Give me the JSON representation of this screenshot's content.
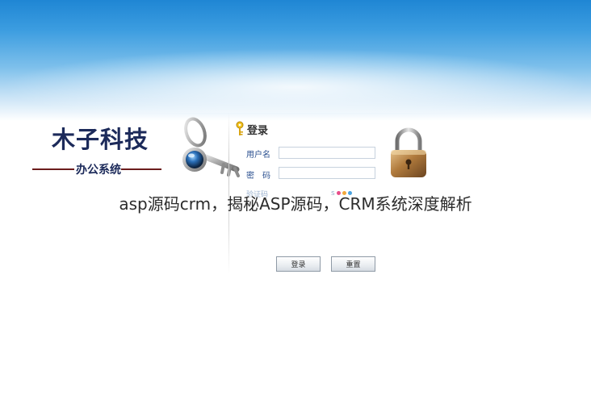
{
  "banner": {
    "caption": "asp源码crm，揭秘ASP源码，CRM系统深度解析"
  },
  "logo": {
    "title": "木子科技",
    "subtitle": "办公系统"
  },
  "login": {
    "heading": "登录",
    "username_label": "用户名",
    "username_value": "",
    "password_label": "密　码",
    "password_value": "",
    "extra_label": "验证码",
    "extra_marks": "s",
    "login_button": "登录",
    "reset_button": "重置"
  },
  "colors": {
    "sky_top": "#1f86d4",
    "logo_text": "#1c2a5a",
    "label_text": "#2a4f8f",
    "accent_line": "#6b1c1c"
  },
  "icons": {
    "key": "key-icon",
    "padlock": "padlock-icon",
    "mini_key": "key-icon"
  }
}
